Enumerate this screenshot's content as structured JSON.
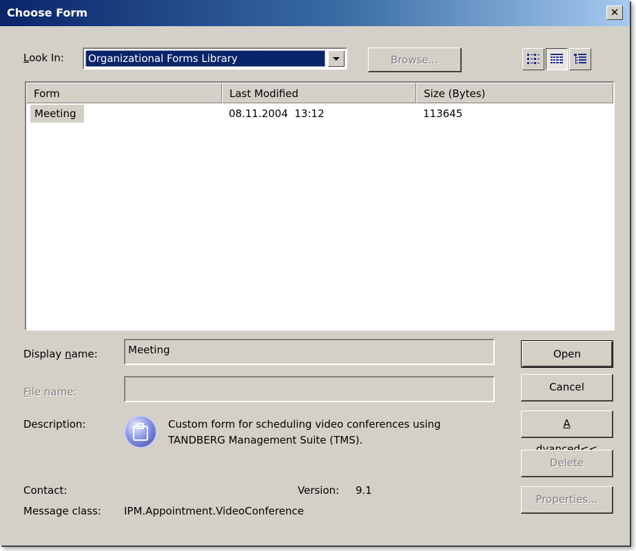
{
  "window": {
    "title": "Choose Form",
    "close_label": "✕"
  },
  "look_in": {
    "label_prefix": "",
    "label_accel": "L",
    "label_rest": "ook In:",
    "value": "Organizational Forms Library"
  },
  "browse_label": "Browse...",
  "view_buttons": [
    "list-view-icon",
    "details-view-icon",
    "tree-view-icon"
  ],
  "table": {
    "columns": [
      "Form",
      "Last Modified",
      "Size (Bytes)"
    ],
    "rows": [
      {
        "form": "Meeting",
        "modified": "08.11.2004  13:12",
        "size": "113645"
      }
    ]
  },
  "display_name": {
    "label_before": "Display ",
    "label_accel": "n",
    "label_after": "ame:",
    "value": "Meeting"
  },
  "file_name": {
    "label_accel": "F",
    "label_rest": "ile name:",
    "value": ""
  },
  "description": {
    "label": "Description:",
    "line1": "Custom form for scheduling video conferences using",
    "line2": "TANDBERG Management Suite (TMS)."
  },
  "contact": {
    "label": "Contact:",
    "value": ""
  },
  "version": {
    "label": "Version:",
    "value": "9.1"
  },
  "message_class": {
    "label": "Message class:",
    "value": "IPM.Appointment.VideoConference"
  },
  "buttons": {
    "open": "Open",
    "cancel": "Cancel",
    "advanced_accel": "A",
    "advanced_rest": "dvanced<<",
    "delete": "Delete",
    "properties": "Properties..."
  },
  "colors": {
    "title_start": "#0a246a",
    "title_end": "#a6caf0",
    "face": "#d4d0c8",
    "selection": "#0a246a"
  }
}
